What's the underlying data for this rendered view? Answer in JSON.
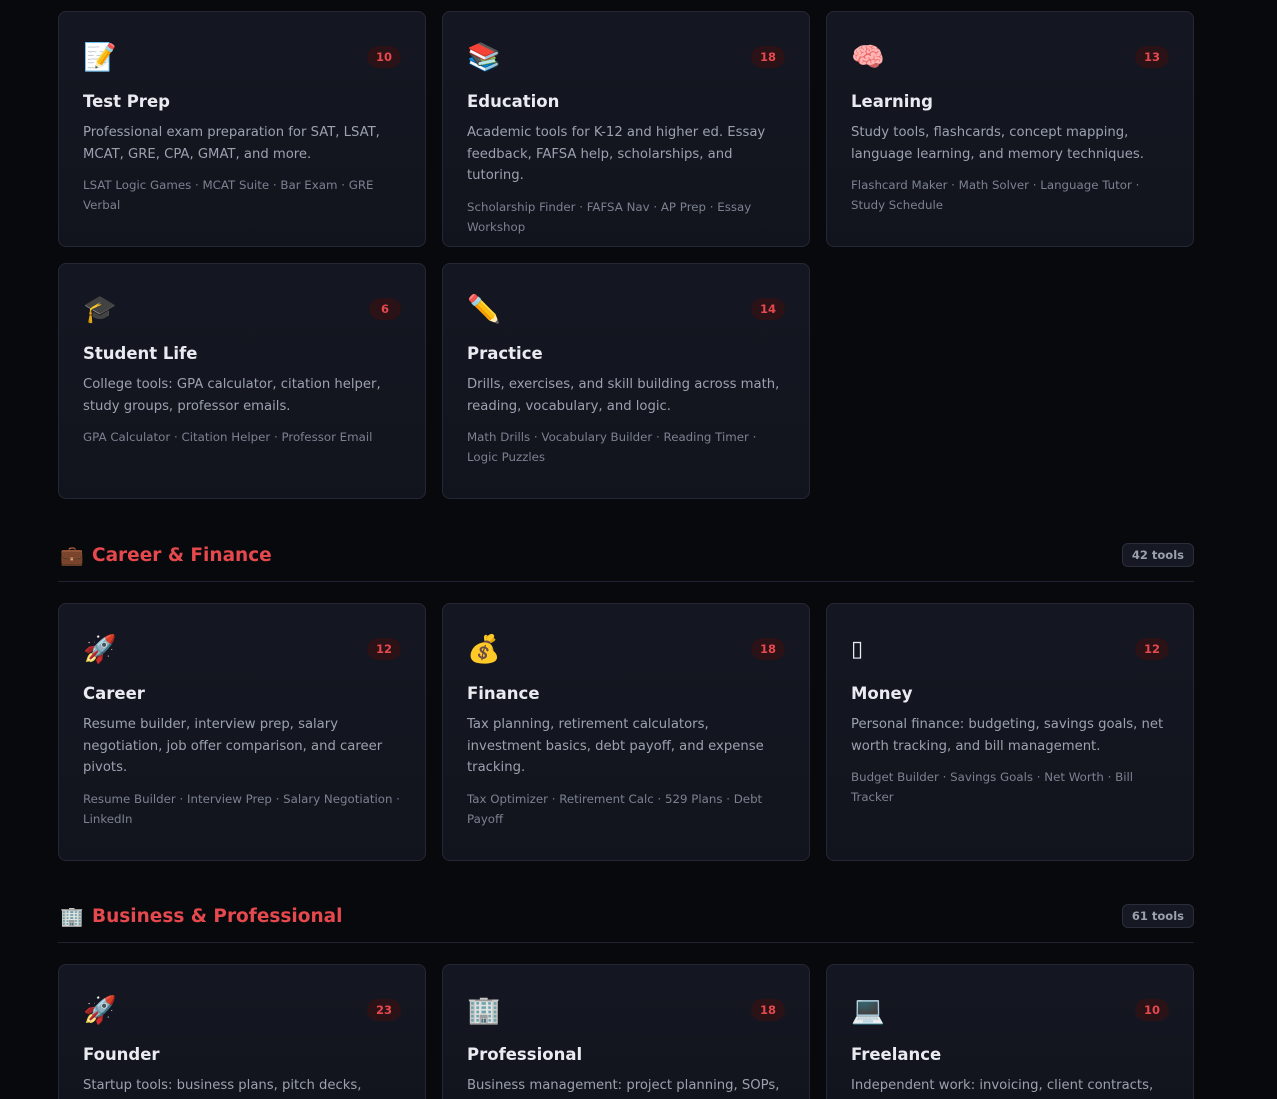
{
  "sections": [
    {
      "cards": [
        {
          "icon": "📝",
          "icon_name": "memo-icon",
          "count": "10",
          "title": "Test Prep",
          "desc": "Professional exam preparation for SAT, LSAT, MCAT, GRE, CPA, GMAT, and more.",
          "tools": "LSAT Logic Games · MCAT Suite · Bar Exam · GRE Verbal"
        },
        {
          "icon": "📚",
          "icon_name": "books-icon",
          "count": "18",
          "title": "Education",
          "desc": "Academic tools for K-12 and higher ed. Essay feedback, FAFSA help, scholarships, and tutoring.",
          "tools": "Scholarship Finder · FAFSA Nav · AP Prep · Essay Workshop"
        },
        {
          "icon": "🧠",
          "icon_name": "brain-icon",
          "count": "13",
          "title": "Learning",
          "desc": "Study tools, flashcards, concept mapping, language learning, and memory techniques.",
          "tools": "Flashcard Maker · Math Solver · Language Tutor · Study Schedule"
        },
        {
          "icon": "🎓",
          "icon_name": "graduation-cap-icon",
          "count": "6",
          "title": "Student Life",
          "desc": "College tools: GPA calculator, citation helper, study groups, professor emails.",
          "tools": "GPA Calculator · Citation Helper · Professor Email"
        },
        {
          "icon": "✏️",
          "icon_name": "pencil-icon",
          "count": "14",
          "title": "Practice",
          "desc": "Drills, exercises, and skill building across math, reading, vocabulary, and logic.",
          "tools": "Math Drills · Vocabulary Builder · Reading Timer · Logic Puzzles"
        }
      ]
    },
    {
      "emoji": "💼",
      "emoji_name": "briefcase-icon",
      "title": "Career & Finance",
      "count": "42 tools",
      "cards": [
        {
          "icon": "🚀",
          "icon_name": "rocket-icon",
          "count": "12",
          "title": "Career",
          "desc": "Resume builder, interview prep, salary negotiation, job offer comparison, and career pivots.",
          "tools": "Resume Builder · Interview Prep · Salary Negotiation · LinkedIn"
        },
        {
          "icon": "💰",
          "icon_name": "money-bag-icon",
          "count": "18",
          "title": "Finance",
          "desc": "Tax planning, retirement calculators, investment basics, debt payoff, and expense tracking.",
          "tools": "Tax Optimizer · Retirement Calc · 529 Plans · Debt Payoff"
        },
        {
          "icon": "▯",
          "icon_name": "missing-glyph-icon",
          "count": "12",
          "title": "Money",
          "desc": "Personal finance: budgeting, savings goals, net worth tracking, and bill management.",
          "tools": "Budget Builder · Savings Goals · Net Worth · Bill Tracker"
        }
      ]
    },
    {
      "emoji": "🏢",
      "emoji_name": "office-building-icon",
      "title": "Business & Professional",
      "count": "61 tools",
      "cards": [
        {
          "icon": "🚀",
          "icon_name": "rocket-icon",
          "count": "23",
          "title": "Founder",
          "desc": "Startup tools: business plans, pitch decks, market",
          "tools": ""
        },
        {
          "icon": "🏢",
          "icon_name": "office-building-icon",
          "count": "18",
          "title": "Professional",
          "desc": "Business management: project planning, SOPs,",
          "tools": ""
        },
        {
          "icon": "💻",
          "icon_name": "laptop-icon",
          "count": "10",
          "title": "Freelance",
          "desc": "Independent work: invoicing, client contracts,",
          "tools": ""
        }
      ]
    }
  ]
}
